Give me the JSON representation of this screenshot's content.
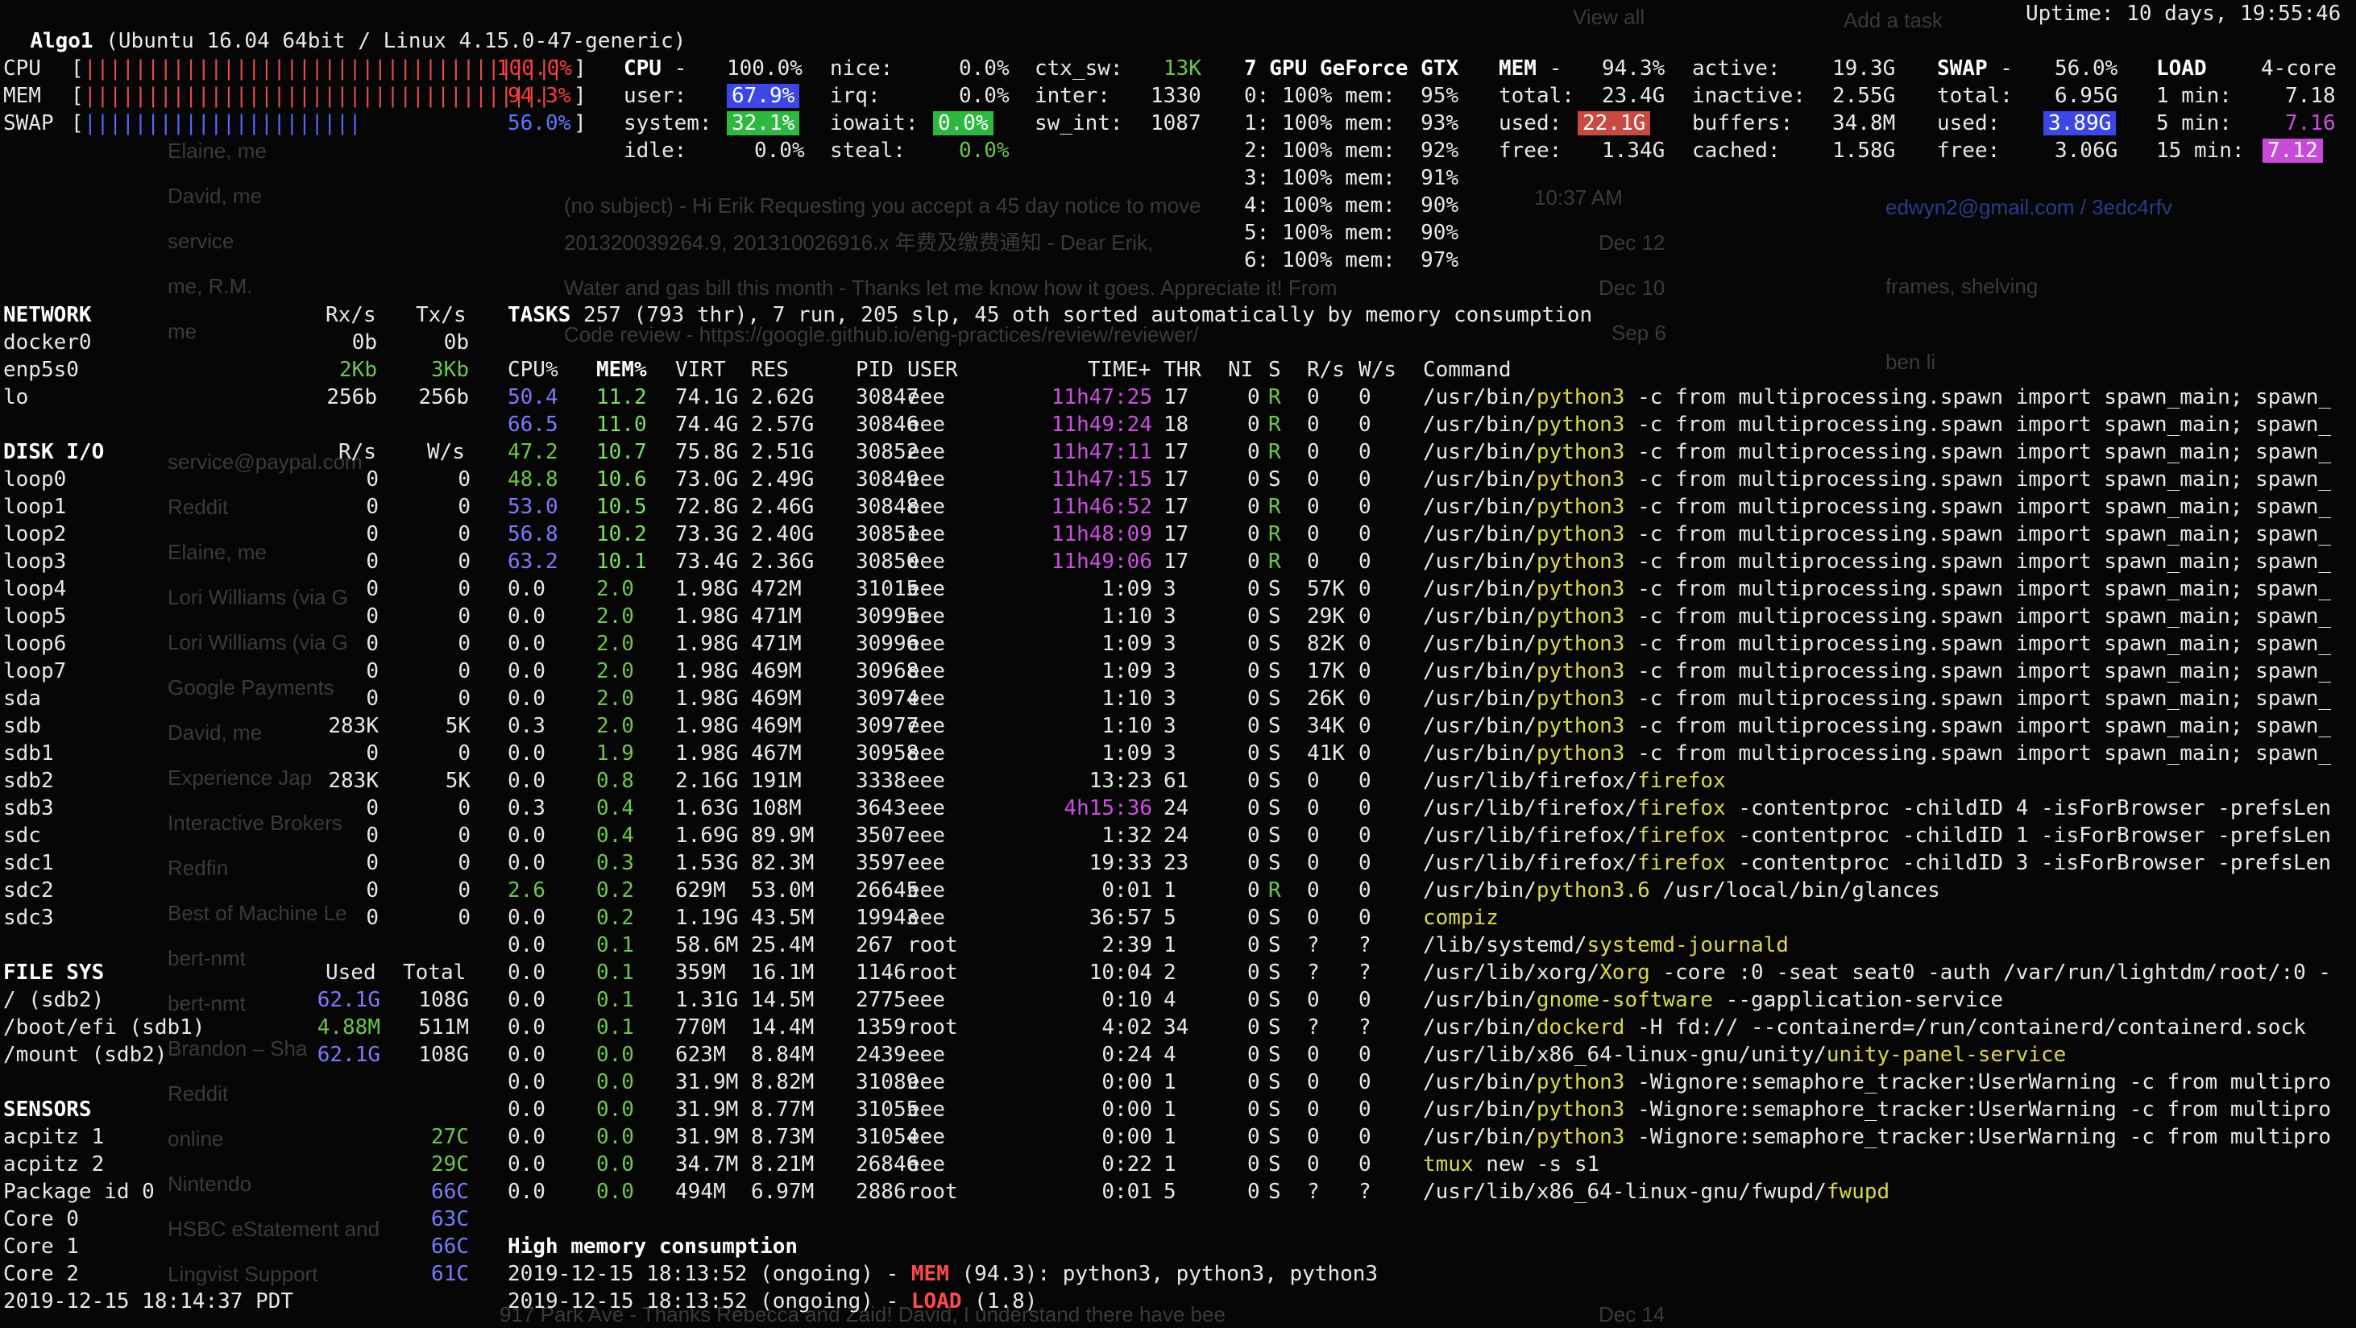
{
  "header": {
    "host": "Algo1",
    "system": "(Ubuntu 16.04 64bit / Linux 4.15.0-47-generic)",
    "uptime": "Uptime: 10 days, 19:55:46"
  },
  "quicklook": {
    "cpu_label": "CPU",
    "cpu_value": "100.0%",
    "mem_label": "MEM",
    "mem_value": "94.3%",
    "swap_label": "SWAP",
    "swap_value": "56.0%"
  },
  "cpu": {
    "title": "CPU",
    "total": "100.0%",
    "user_label": "user:",
    "user": "67.9%",
    "system_label": "system:",
    "system": "32.1%",
    "idle_label": "idle:",
    "idle": "0.0%",
    "nice_label": "nice:",
    "nice": "0.0%",
    "irq_label": "irq:",
    "irq": "0.0%",
    "iowait_label": "iowait:",
    "iowait": "0.0%",
    "steal_label": "steal:",
    "steal": "0.0%",
    "ctx_sw_label": "ctx_sw:",
    "ctx_sw": "13K",
    "inter_label": "inter:",
    "inter": "1330",
    "sw_int_label": "sw_int:",
    "sw_int": "1087"
  },
  "gpu": {
    "title": "7 GPU GeForce GTX",
    "rows": [
      "0: 100% mem:  95%",
      "1: 100% mem:  93%",
      "2: 100% mem:  92%",
      "3: 100% mem:  91%",
      "4: 100% mem:  90%",
      "5: 100% mem:  90%",
      "6: 100% mem:  97%"
    ]
  },
  "mem": {
    "title": "MEM",
    "percent": "94.3%",
    "total_label": "total:",
    "total": "23.4G",
    "used_label": "used:",
    "used": "22.1G",
    "free_label": "free:",
    "free": "1.34G",
    "active_label": "active:",
    "active": "19.3G",
    "inactive_label": "inactive:",
    "inactive": "2.55G",
    "buffers_label": "buffers:",
    "buffers": "34.8M",
    "cached_label": "cached:",
    "cached": "1.58G"
  },
  "swap": {
    "title": "SWAP",
    "percent": "56.0%",
    "total_label": "total:",
    "total": "6.95G",
    "used_label": "used:",
    "used": "3.89G",
    "free_label": "free:",
    "free": "3.06G"
  },
  "load": {
    "title": "LOAD",
    "cores": "4-core",
    "m1_label": "1 min:",
    "m1": "7.18",
    "m5_label": "5 min:",
    "m5": "7.16",
    "m15_label": "15 min:",
    "m15": "7.12"
  },
  "network": {
    "title": "NETWORK",
    "rx_header": "Rx/s",
    "tx_header": "Tx/s",
    "rows": [
      {
        "name": "docker0",
        "rx": "0b",
        "tx": "0b"
      },
      {
        "name": "enp5s0",
        "rx": "2Kb",
        "tx": "3Kb"
      },
      {
        "name": "lo",
        "rx": "256b",
        "tx": "256b"
      }
    ]
  },
  "disk": {
    "title": "DISK I/O",
    "r_header": "R/s",
    "w_header": "W/s",
    "rows": [
      {
        "name": "loop0",
        "r": "0",
        "w": "0"
      },
      {
        "name": "loop1",
        "r": "0",
        "w": "0"
      },
      {
        "name": "loop2",
        "r": "0",
        "w": "0"
      },
      {
        "name": "loop3",
        "r": "0",
        "w": "0"
      },
      {
        "name": "loop4",
        "r": "0",
        "w": "0"
      },
      {
        "name": "loop5",
        "r": "0",
        "w": "0"
      },
      {
        "name": "loop6",
        "r": "0",
        "w": "0"
      },
      {
        "name": "loop7",
        "r": "0",
        "w": "0"
      },
      {
        "name": "sda",
        "r": "0",
        "w": "0"
      },
      {
        "name": "sdb",
        "r": "283K",
        "w": "5K"
      },
      {
        "name": "sdb1",
        "r": "0",
        "w": "0"
      },
      {
        "name": "sdb2",
        "r": "283K",
        "w": "5K"
      },
      {
        "name": "sdb3",
        "r": "0",
        "w": "0"
      },
      {
        "name": "sdc",
        "r": "0",
        "w": "0"
      },
      {
        "name": "sdc1",
        "r": "0",
        "w": "0"
      },
      {
        "name": "sdc2",
        "r": "0",
        "w": "0"
      },
      {
        "name": "sdc3",
        "r": "0",
        "w": "0"
      }
    ]
  },
  "filesys": {
    "title": "FILE SYS",
    "used_header": "Used",
    "total_header": "Total",
    "rows": [
      {
        "name": "/ (sdb2)",
        "used": "62.1G",
        "total": "108G"
      },
      {
        "name": "/boot/efi (sdb1)",
        "used": "4.88M",
        "total": "511M"
      },
      {
        "name": "/mount (sdb2)",
        "used": "62.1G",
        "total": "108G"
      }
    ]
  },
  "sensors": {
    "title": "SENSORS",
    "rows": [
      {
        "name": "acpitz 1",
        "value": "27C"
      },
      {
        "name": "acpitz 2",
        "value": "29C"
      },
      {
        "name": "Package id 0",
        "value": "66C"
      },
      {
        "name": "Core 0",
        "value": "63C"
      },
      {
        "name": "Core 1",
        "value": "66C"
      },
      {
        "name": "Core 2",
        "value": "61C"
      }
    ]
  },
  "footer_time": "2019-12-15 18:14:37 PDT",
  "tasks": {
    "title": "TASKS",
    "summary": "257 (793 thr), 7 run, 205 slp, 45 oth sorted automatically by memory consumption"
  },
  "process_headers": {
    "cpu": "CPU%",
    "mem": "MEM%",
    "virt": "VIRT",
    "res": "RES",
    "pid": "PID",
    "user": "USER",
    "time": "TIME+",
    "thr": "THR",
    "ni": "NI",
    "s": "S",
    "rs": "R/s",
    "ws": "W/s",
    "cmd": "Command"
  },
  "processes": [
    {
      "cpu": "50.4",
      "mem": "11.2",
      "virt": "74.1G",
      "res": "2.62G",
      "pid": "30847",
      "user": "eee",
      "time": "11h47:25",
      "thr": "17",
      "ni": "0",
      "s": "R",
      "rs": "0",
      "ws": "0",
      "cmd_pre": "/usr/bin/",
      "cmd_hl": "python3",
      "cmd_post": " -c from multiprocessing.spawn import spawn_main; spawn_"
    },
    {
      "cpu": "66.5",
      "mem": "11.0",
      "virt": "74.4G",
      "res": "2.57G",
      "pid": "30846",
      "user": "eee",
      "time": "11h49:24",
      "thr": "18",
      "ni": "0",
      "s": "R",
      "rs": "0",
      "ws": "0",
      "cmd_pre": "/usr/bin/",
      "cmd_hl": "python3",
      "cmd_post": " -c from multiprocessing.spawn import spawn_main; spawn_"
    },
    {
      "cpu": "47.2",
      "mem": "10.7",
      "virt": "75.8G",
      "res": "2.51G",
      "pid": "30852",
      "user": "eee",
      "time": "11h47:11",
      "thr": "17",
      "ni": "0",
      "s": "R",
      "rs": "0",
      "ws": "0",
      "cmd_pre": "/usr/bin/",
      "cmd_hl": "python3",
      "cmd_post": " -c from multiprocessing.spawn import spawn_main; spawn_"
    },
    {
      "cpu": "48.8",
      "mem": "10.6",
      "virt": "73.0G",
      "res": "2.49G",
      "pid": "30849",
      "user": "eee",
      "time": "11h47:15",
      "thr": "17",
      "ni": "0",
      "s": "S",
      "rs": "0",
      "ws": "0",
      "cmd_pre": "/usr/bin/",
      "cmd_hl": "python3",
      "cmd_post": " -c from multiprocessing.spawn import spawn_main; spawn_"
    },
    {
      "cpu": "53.0",
      "mem": "10.5",
      "virt": "72.8G",
      "res": "2.46G",
      "pid": "30848",
      "user": "eee",
      "time": "11h46:52",
      "thr": "17",
      "ni": "0",
      "s": "R",
      "rs": "0",
      "ws": "0",
      "cmd_pre": "/usr/bin/",
      "cmd_hl": "python3",
      "cmd_post": " -c from multiprocessing.spawn import spawn_main; spawn_"
    },
    {
      "cpu": "56.8",
      "mem": "10.2",
      "virt": "73.3G",
      "res": "2.40G",
      "pid": "30851",
      "user": "eee",
      "time": "11h48:09",
      "thr": "17",
      "ni": "0",
      "s": "R",
      "rs": "0",
      "ws": "0",
      "cmd_pre": "/usr/bin/",
      "cmd_hl": "python3",
      "cmd_post": " -c from multiprocessing.spawn import spawn_main; spawn_"
    },
    {
      "cpu": "63.2",
      "mem": "10.1",
      "virt": "73.4G",
      "res": "2.36G",
      "pid": "30850",
      "user": "eee",
      "time": "11h49:06",
      "thr": "17",
      "ni": "0",
      "s": "R",
      "rs": "0",
      "ws": "0",
      "cmd_pre": "/usr/bin/",
      "cmd_hl": "python3",
      "cmd_post": " -c from multiprocessing.spawn import spawn_main; spawn_"
    },
    {
      "cpu": "0.0",
      "mem": "2.0",
      "virt": "1.98G",
      "res": "472M",
      "pid": "31015",
      "user": "eee",
      "time": "1:09",
      "thr": "3",
      "ni": "0",
      "s": "S",
      "rs": "57K",
      "ws": "0",
      "cmd_pre": "/usr/bin/",
      "cmd_hl": "python3",
      "cmd_post": " -c from multiprocessing.spawn import spawn_main; spawn_"
    },
    {
      "cpu": "0.0",
      "mem": "2.0",
      "virt": "1.98G",
      "res": "471M",
      "pid": "30995",
      "user": "eee",
      "time": "1:10",
      "thr": "3",
      "ni": "0",
      "s": "S",
      "rs": "29K",
      "ws": "0",
      "cmd_pre": "/usr/bin/",
      "cmd_hl": "python3",
      "cmd_post": " -c from multiprocessing.spawn import spawn_main; spawn_"
    },
    {
      "cpu": "0.0",
      "mem": "2.0",
      "virt": "1.98G",
      "res": "471M",
      "pid": "30996",
      "user": "eee",
      "time": "1:09",
      "thr": "3",
      "ni": "0",
      "s": "S",
      "rs": "82K",
      "ws": "0",
      "cmd_pre": "/usr/bin/",
      "cmd_hl": "python3",
      "cmd_post": " -c from multiprocessing.spawn import spawn_main; spawn_"
    },
    {
      "cpu": "0.0",
      "mem": "2.0",
      "virt": "1.98G",
      "res": "469M",
      "pid": "30968",
      "user": "eee",
      "time": "1:09",
      "thr": "3",
      "ni": "0",
      "s": "S",
      "rs": "17K",
      "ws": "0",
      "cmd_pre": "/usr/bin/",
      "cmd_hl": "python3",
      "cmd_post": " -c from multiprocessing.spawn import spawn_main; spawn_"
    },
    {
      "cpu": "0.0",
      "mem": "2.0",
      "virt": "1.98G",
      "res": "469M",
      "pid": "30974",
      "user": "eee",
      "time": "1:10",
      "thr": "3",
      "ni": "0",
      "s": "S",
      "rs": "26K",
      "ws": "0",
      "cmd_pre": "/usr/bin/",
      "cmd_hl": "python3",
      "cmd_post": " -c from multiprocessing.spawn import spawn_main; spawn_"
    },
    {
      "cpu": "0.3",
      "mem": "2.0",
      "virt": "1.98G",
      "res": "469M",
      "pid": "30977",
      "user": "eee",
      "time": "1:10",
      "thr": "3",
      "ni": "0",
      "s": "S",
      "rs": "34K",
      "ws": "0",
      "cmd_pre": "/usr/bin/",
      "cmd_hl": "python3",
      "cmd_post": " -c from multiprocessing.spawn import spawn_main; spawn_"
    },
    {
      "cpu": "0.0",
      "mem": "1.9",
      "virt": "1.98G",
      "res": "467M",
      "pid": "30958",
      "user": "eee",
      "time": "1:09",
      "thr": "3",
      "ni": "0",
      "s": "S",
      "rs": "41K",
      "ws": "0",
      "cmd_pre": "/usr/bin/",
      "cmd_hl": "python3",
      "cmd_post": " -c from multiprocessing.spawn import spawn_main; spawn_"
    },
    {
      "cpu": "0.0",
      "mem": "0.8",
      "virt": "2.16G",
      "res": "191M",
      "pid": "3338",
      "user": "eee",
      "time": "13:23",
      "thr": "61",
      "ni": "0",
      "s": "S",
      "rs": "0",
      "ws": "0",
      "cmd_pre": "/usr/lib/firefox/",
      "cmd_hl": "firefox",
      "cmd_post": ""
    },
    {
      "cpu": "0.3",
      "mem": "0.4",
      "virt": "1.63G",
      "res": "108M",
      "pid": "3643",
      "user": "eee",
      "time": "4h15:36",
      "thr": "24",
      "ni": "0",
      "s": "S",
      "rs": "0",
      "ws": "0",
      "cmd_pre": "/usr/lib/firefox/",
      "cmd_hl": "firefox",
      "cmd_post": " -contentproc -childID 4 -isForBrowser -prefsLen"
    },
    {
      "cpu": "0.0",
      "mem": "0.4",
      "virt": "1.69G",
      "res": "89.9M",
      "pid": "3507",
      "user": "eee",
      "time": "1:32",
      "thr": "24",
      "ni": "0",
      "s": "S",
      "rs": "0",
      "ws": "0",
      "cmd_pre": "/usr/lib/firefox/",
      "cmd_hl": "firefox",
      "cmd_post": " -contentproc -childID 1 -isForBrowser -prefsLen"
    },
    {
      "cpu": "0.0",
      "mem": "0.3",
      "virt": "1.53G",
      "res": "82.3M",
      "pid": "3597",
      "user": "eee",
      "time": "19:33",
      "thr": "23",
      "ni": "0",
      "s": "S",
      "rs": "0",
      "ws": "0",
      "cmd_pre": "/usr/lib/firefox/",
      "cmd_hl": "firefox",
      "cmd_post": " -contentproc -childID 3 -isForBrowser -prefsLen"
    },
    {
      "cpu": "2.6",
      "mem": "0.2",
      "virt": "629M",
      "res": "53.0M",
      "pid": "26645",
      "user": "eee",
      "time": "0:01",
      "thr": "1",
      "ni": "0",
      "s": "R",
      "rs": "0",
      "ws": "0",
      "cmd_pre": "/usr/bin/",
      "cmd_hl": "python3.6",
      "cmd_post": " /usr/local/bin/glances"
    },
    {
      "cpu": "0.0",
      "mem": "0.2",
      "virt": "1.19G",
      "res": "43.5M",
      "pid": "19943",
      "user": "eee",
      "time": "36:57",
      "thr": "5",
      "ni": "0",
      "s": "S",
      "rs": "0",
      "ws": "0",
      "cmd_pre": "",
      "cmd_hl": "compiz",
      "cmd_post": ""
    },
    {
      "cpu": "0.0",
      "mem": "0.1",
      "virt": "58.6M",
      "res": "25.4M",
      "pid": "267",
      "user": "root",
      "time": "2:39",
      "thr": "1",
      "ni": "0",
      "s": "S",
      "rs": "?",
      "ws": "?",
      "cmd_pre": "/lib/systemd/",
      "cmd_hl": "systemd-journald",
      "cmd_post": ""
    },
    {
      "cpu": "0.0",
      "mem": "0.1",
      "virt": "359M",
      "res": "16.1M",
      "pid": "1146",
      "user": "root",
      "time": "10:04",
      "thr": "2",
      "ni": "0",
      "s": "S",
      "rs": "?",
      "ws": "?",
      "cmd_pre": "/usr/lib/xorg/",
      "cmd_hl": "Xorg",
      "cmd_post": " -core :0 -seat seat0 -auth /var/run/lightdm/root/:0 -"
    },
    {
      "cpu": "0.0",
      "mem": "0.1",
      "virt": "1.31G",
      "res": "14.5M",
      "pid": "2775",
      "user": "eee",
      "time": "0:10",
      "thr": "4",
      "ni": "0",
      "s": "S",
      "rs": "0",
      "ws": "0",
      "cmd_pre": "/usr/bin/",
      "cmd_hl": "gnome-software",
      "cmd_post": " --gapplication-service"
    },
    {
      "cpu": "0.0",
      "mem": "0.1",
      "virt": "770M",
      "res": "14.4M",
      "pid": "1359",
      "user": "root",
      "time": "4:02",
      "thr": "34",
      "ni": "0",
      "s": "S",
      "rs": "?",
      "ws": "?",
      "cmd_pre": "/usr/bin/",
      "cmd_hl": "dockerd",
      "cmd_post": " -H fd:// --containerd=/run/containerd/containerd.sock"
    },
    {
      "cpu": "0.0",
      "mem": "0.0",
      "virt": "623M",
      "res": "8.84M",
      "pid": "2439",
      "user": "eee",
      "time": "0:24",
      "thr": "4",
      "ni": "0",
      "s": "S",
      "rs": "0",
      "ws": "0",
      "cmd_pre": "/usr/lib/x86_64-linux-gnu/unity/",
      "cmd_hl": "unity-panel-service",
      "cmd_post": ""
    },
    {
      "cpu": "0.0",
      "mem": "0.0",
      "virt": "31.9M",
      "res": "8.82M",
      "pid": "31089",
      "user": "eee",
      "time": "0:00",
      "thr": "1",
      "ni": "0",
      "s": "S",
      "rs": "0",
      "ws": "0",
      "cmd_pre": "/usr/bin/",
      "cmd_hl": "python3",
      "cmd_post": " -Wignore:semaphore_tracker:UserWarning -c from multipro"
    },
    {
      "cpu": "0.0",
      "mem": "0.0",
      "virt": "31.9M",
      "res": "8.77M",
      "pid": "31055",
      "user": "eee",
      "time": "0:00",
      "thr": "1",
      "ni": "0",
      "s": "S",
      "rs": "0",
      "ws": "0",
      "cmd_pre": "/usr/bin/",
      "cmd_hl": "python3",
      "cmd_post": " -Wignore:semaphore_tracker:UserWarning -c from multipro"
    },
    {
      "cpu": "0.0",
      "mem": "0.0",
      "virt": "31.9M",
      "res": "8.73M",
      "pid": "31054",
      "user": "eee",
      "time": "0:00",
      "thr": "1",
      "ni": "0",
      "s": "S",
      "rs": "0",
      "ws": "0",
      "cmd_pre": "/usr/bin/",
      "cmd_hl": "python3",
      "cmd_post": " -Wignore:semaphore_tracker:UserWarning -c from multipro"
    },
    {
      "cpu": "0.0",
      "mem": "0.0",
      "virt": "34.7M",
      "res": "8.21M",
      "pid": "26846",
      "user": "eee",
      "time": "0:22",
      "thr": "1",
      "ni": "0",
      "s": "S",
      "rs": "0",
      "ws": "0",
      "cmd_pre": "",
      "cmd_hl": "tmux",
      "cmd_post": " new -s s1"
    },
    {
      "cpu": "0.0",
      "mem": "0.0",
      "virt": "494M",
      "res": "6.97M",
      "pid": "2886",
      "user": "root",
      "time": "0:01",
      "thr": "5",
      "ni": "0",
      "s": "S",
      "rs": "?",
      "ws": "?",
      "cmd_pre": "/usr/lib/x86_64-linux-gnu/fwupd/",
      "cmd_hl": "fwupd",
      "cmd_post": ""
    }
  ],
  "alerts": {
    "title": "High memory consumption",
    "rows": [
      {
        "time": "2019-12-15 18:13:52 (ongoing) - ",
        "kind": "MEM",
        "rest": " (94.3): python3, python3, python3"
      },
      {
        "time": "2019-12-15 18:13:52 (ongoing) - ",
        "kind": "LOAD",
        "rest": " (1.8)"
      }
    ]
  },
  "background_ghost": {
    "view_all": "View all",
    "add_task": "Add a task",
    "email_row1": "edwyn2@gmail.com / 3edc4rfv",
    "frames": "frames, shelving",
    "ben": "ben li",
    "senders": [
      "Elaine, me",
      "David, me",
      "service",
      "me, R.M.",
      "me",
      "service@paypal.com",
      "Reddit",
      "Elaine, me",
      "Lori Williams (via G",
      "Lori Williams (via G",
      "Google Payments",
      "David, me",
      "Experience Jap",
      "Interactive Brokers",
      "Redfin",
      "Best of Machine Le",
      "bert-nmt",
      "bert-nmt",
      "Brandon – Sha",
      "Reddit",
      "online",
      "Nintendo",
      "HSBC eStatement and",
      "Lingvist Support"
    ],
    "inbox_subject_1": "(no subject) - Hi Erik Requesting you accept a 45 day notice to move",
    "inbox_subject_2": "201320039264.9, 201310026916.x 年费及缴费通知 - Dear Erik,",
    "inbox_subject_3": "Water and gas bill this month - Thanks let me know how it goes. Appreciate it! From",
    "code_review": "Code review - https://google.github.io/eng-practices/review/reviewer/",
    "time_1": "10:37 AM",
    "date_1": "Dec 12",
    "date_2": "Dec 10",
    "date_3": "Sep 6",
    "date_4": "Dec 14",
    "bottom_text": "917 Park Ave - Thanks Rebecca and Zaid! David, I understand there have bee"
  },
  "colors": {
    "background": "#060606",
    "green": "#6ec64b",
    "blue": "#7a7aff",
    "magenta": "#cc4fe0",
    "yellow": "#d8d84a",
    "red_highlight": "#c84a43",
    "blue_highlight": "#3d47e6",
    "green_highlight": "#2fb83f",
    "magenta_highlight": "#c84ad9"
  }
}
